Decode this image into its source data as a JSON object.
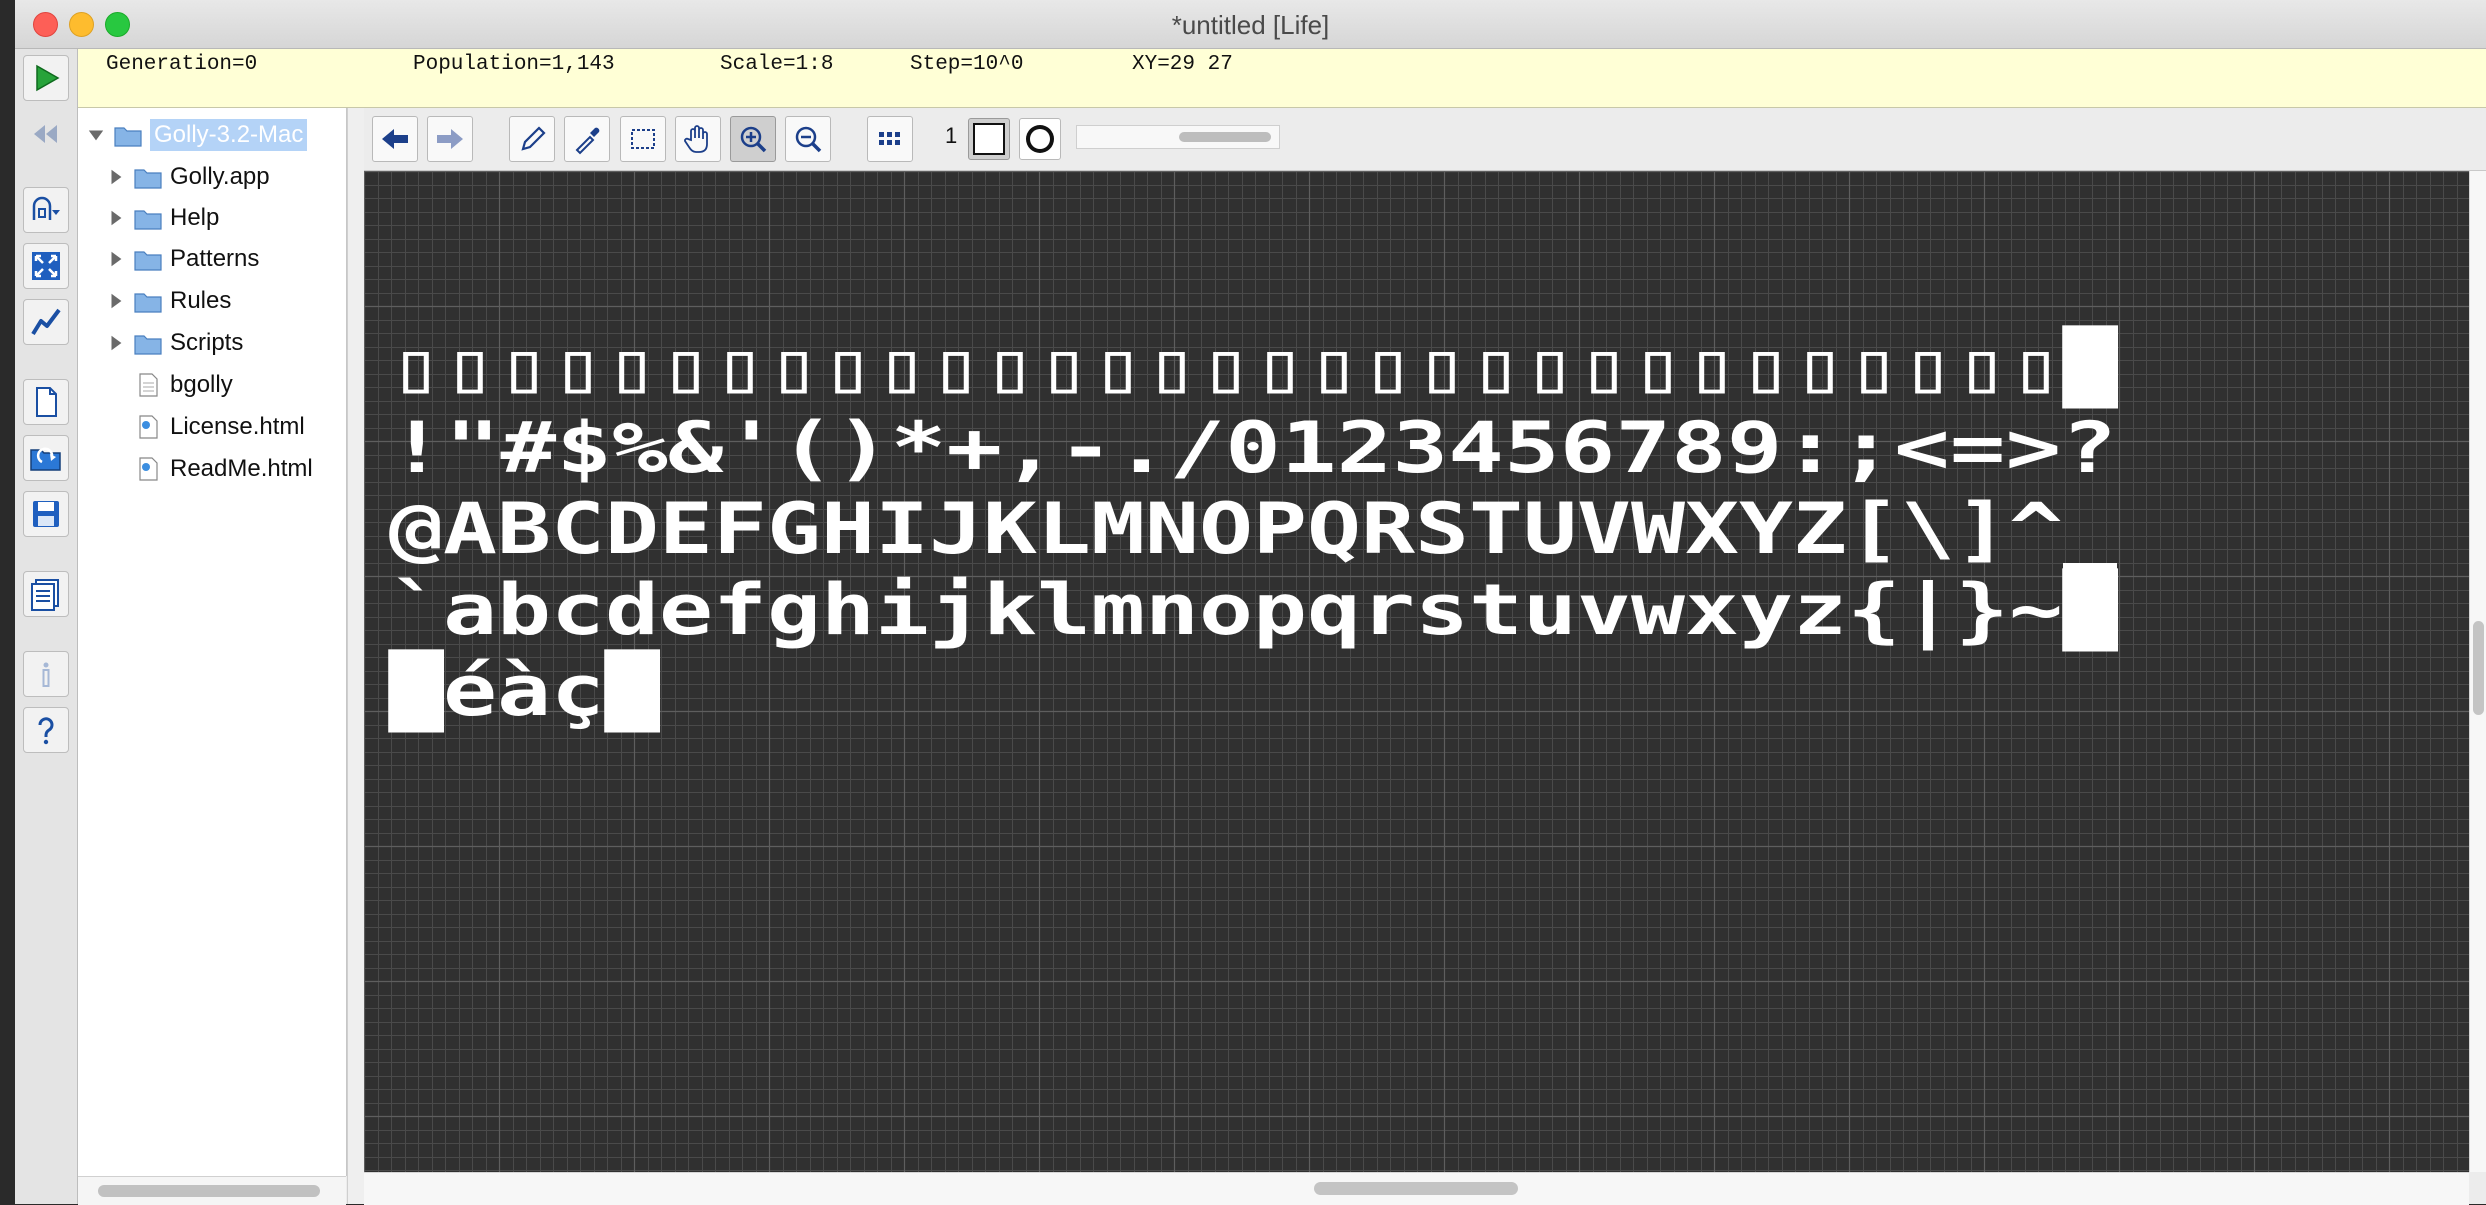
{
  "window": {
    "title": "*untitled [Life]"
  },
  "status": {
    "generation": "Generation=0",
    "population": "Population=1,143",
    "scale": "Scale=1:8",
    "step": "Step=10^0",
    "xy": "XY=29 27"
  },
  "left_toolbar": [
    {
      "name": "start-generating-button",
      "icon": "play-icon"
    },
    {
      "name": "reset-button",
      "icon": "rewind-icon"
    },
    {
      "name": "rule-button",
      "icon": "algorithm-icon"
    },
    {
      "name": "fit-pattern-button",
      "icon": "fit-icon"
    },
    {
      "name": "show-info-button",
      "icon": "graph-icon"
    },
    {
      "name": "new-pattern-button",
      "icon": "new-file-icon"
    },
    {
      "name": "open-pattern-button",
      "icon": "open-folder-icon"
    },
    {
      "name": "save-pattern-button",
      "icon": "save-icon"
    },
    {
      "name": "show-files-button",
      "icon": "files-icon"
    },
    {
      "name": "pattern-info-button",
      "icon": "info-icon"
    },
    {
      "name": "help-button",
      "icon": "help-icon"
    }
  ],
  "tree": {
    "root": "Golly-3.2-Mac",
    "items": [
      {
        "label": "Golly.app",
        "kind": "folder"
      },
      {
        "label": "Help",
        "kind": "folder"
      },
      {
        "label": "Patterns",
        "kind": "folder"
      },
      {
        "label": "Rules",
        "kind": "folder"
      },
      {
        "label": "Scripts",
        "kind": "folder"
      },
      {
        "label": "bgolly",
        "kind": "file"
      },
      {
        "label": "License.html",
        "kind": "html"
      },
      {
        "label": "ReadMe.html",
        "kind": "html"
      }
    ]
  },
  "edit_toolbar": {
    "tools": [
      "back-icon",
      "forward-icon",
      "pencil-icon",
      "eyedropper-icon",
      "select-icon",
      "hand-icon",
      "zoom-in-icon",
      "zoom-out-icon",
      "all-states-icon"
    ],
    "state_label": "1"
  },
  "pattern": {
    "rows": [
      "▯▯▯▯▯▯▯▯▯▯▯▯▯▯▯▯▯▯▯▯▯▯▯▯▯▯▯▯▯▯▯█",
      " !\"#$%&'()*+,-./0123456789:;<=>?",
      "@ABCDEFGHIJKLMNOPQRSTUVWXYZ[\\]^_",
      "`abcdefghijklmnopqrstuvwxyz{|}~█",
      "█éàç█"
    ],
    "colors": {
      "dead": "#303030",
      "alive": "#ffffff",
      "grid": "#4a4a4a",
      "grid_major": "#5e5e5e"
    }
  }
}
